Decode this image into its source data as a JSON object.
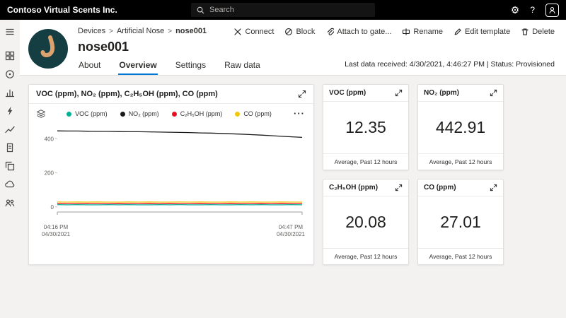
{
  "topbar": {
    "app_title": "Contoso Virtual Scents Inc.",
    "search_placeholder": "Search",
    "help_label": "?",
    "icons": [
      "search-icon",
      "gear-icon",
      "help-icon",
      "user-icon"
    ]
  },
  "sidebar": {
    "icons": [
      "menu-icon",
      "dashboard-icon",
      "devices-icon",
      "device-groups-icon",
      "rules-icon",
      "analytics-icon",
      "jobs-icon",
      "device-templates-icon",
      "data-export-icon",
      "administration-icon"
    ]
  },
  "header": {
    "breadcrumb": [
      "Devices",
      "Artificial Nose",
      "nose001"
    ],
    "breadcrumb_separator": ">",
    "device_title": "nose001",
    "toolbar": [
      {
        "label": "Connect",
        "icon": "connect-icon"
      },
      {
        "label": "Block",
        "icon": "block-icon"
      },
      {
        "label": "Attach to gate...",
        "icon": "attach-icon"
      },
      {
        "label": "Rename",
        "icon": "rename-icon"
      },
      {
        "label": "Edit template",
        "icon": "edit-template-icon"
      },
      {
        "label": "Delete",
        "icon": "delete-icon"
      }
    ],
    "tabs": [
      {
        "label": "About",
        "active": false
      },
      {
        "label": "Overview",
        "active": true
      },
      {
        "label": "Settings",
        "active": false
      },
      {
        "label": "Raw data",
        "active": false
      }
    ],
    "status_line": "Last data received: 4/30/2021, 4:46:27 PM  |  Status: Provisioned"
  },
  "chart_card": {
    "more_label": "···"
  },
  "kpi_cards": [
    {
      "title": "VOC (ppm)",
      "value": "12.35",
      "subtitle": "Average, Past 12 hours"
    },
    {
      "title": "NO₂ (ppm)",
      "value": "442.91",
      "subtitle": "Average, Past 12 hours"
    },
    {
      "title": "C₂H₅OH (ppm)",
      "value": "20.08",
      "subtitle": "Average, Past 12 hours"
    },
    {
      "title": "CO (ppm)",
      "value": "27.01",
      "subtitle": "Average, Past 12 hours"
    }
  ],
  "chart_data": {
    "type": "line",
    "title": "VOC (ppm), NO₂ (ppm), C₂H₅OH (ppm), CO (ppm)",
    "legend_position": "top",
    "grid": false,
    "ylim": [
      -30,
      480
    ],
    "y_ticks": [
      0,
      200,
      400
    ],
    "x_labels": [
      {
        "time": "04:16 PM",
        "date": "04/30/2021"
      },
      {
        "time": "04:47 PM",
        "date": "04/30/2021"
      }
    ],
    "series": [
      {
        "name": "VOC (ppm)",
        "color": "#00B294",
        "values": [
          13,
          12,
          13,
          12,
          12,
          13,
          12,
          13,
          12,
          12,
          13,
          12,
          13,
          12,
          12,
          13,
          12,
          12,
          13,
          12,
          13,
          12,
          12,
          13,
          12
        ]
      },
      {
        "name": "NO₂ (ppm)",
        "color": "#1B1A19",
        "values": [
          446,
          445,
          445,
          444,
          443,
          443,
          442,
          441,
          441,
          440,
          439,
          438,
          437,
          436,
          434,
          433,
          431,
          429,
          427,
          424,
          421,
          418,
          414,
          411,
          408
        ]
      },
      {
        "name": "C₂H₅OH (ppm)",
        "color": "#E81123",
        "values": [
          21,
          20,
          20,
          21,
          20,
          20,
          21,
          20,
          20,
          21,
          20,
          21,
          20,
          20,
          21,
          20,
          20,
          21,
          20,
          20,
          21,
          20,
          21,
          20,
          20
        ]
      },
      {
        "name": "CO (ppm)",
        "color": "#F2C80F",
        "values": [
          29,
          28,
          29,
          28,
          29,
          28,
          28,
          29,
          28,
          29,
          28,
          28,
          29,
          28,
          29,
          28,
          28,
          29,
          28,
          29,
          28,
          28,
          29,
          28,
          28
        ]
      }
    ]
  },
  "colors": {
    "accent": "#0078D4",
    "avatar_bg": "#153E43",
    "avatar_nose": "#DCA36F"
  }
}
